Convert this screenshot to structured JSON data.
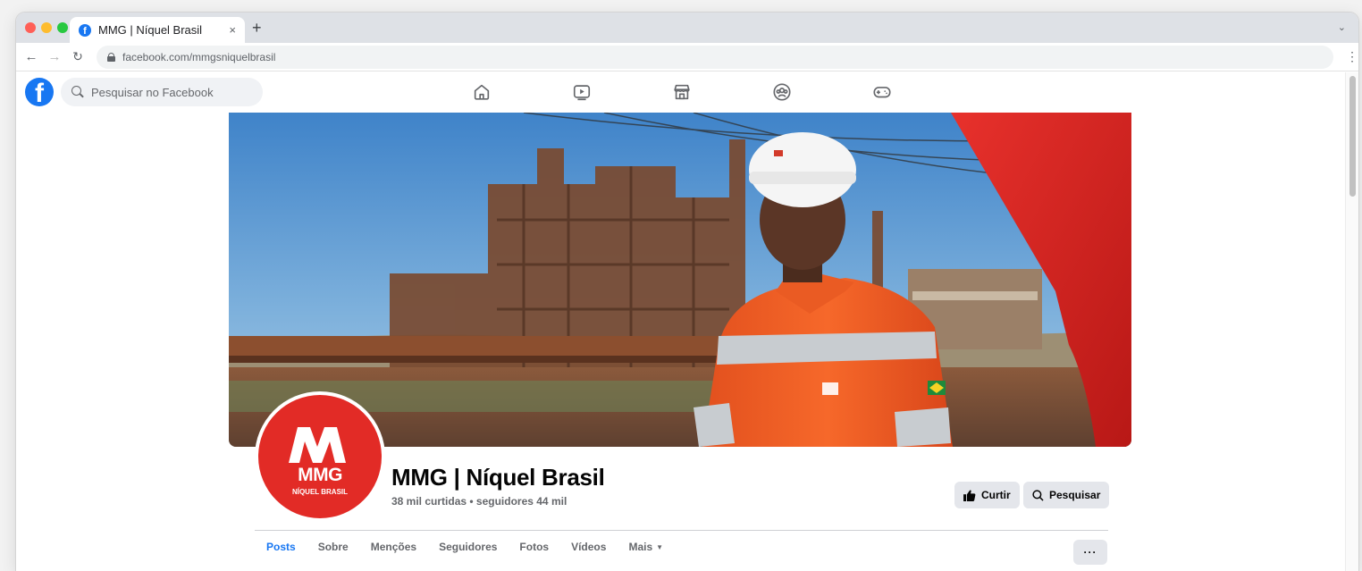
{
  "browser": {
    "tab_title": "MMG | Níquel Brasil",
    "url": "facebook.com/mmgsniquelbrasil",
    "new_tab": "+",
    "close_tab": "×"
  },
  "facebook": {
    "logo": "f",
    "search_placeholder": "Pesquisar no Facebook",
    "nav_icons": [
      "home-icon",
      "watch-icon",
      "marketplace-icon",
      "groups-icon",
      "gaming-icon"
    ]
  },
  "page": {
    "name": "MMG | Níquel Brasil",
    "stats": "38 mil curtidas • seguidores 44 mil",
    "avatar_logo": "MMG",
    "avatar_sub": "NÍQUEL BRASIL",
    "like_button": "Curtir",
    "search_button": "Pesquisar",
    "more_button": "···",
    "tabs": [
      "Posts",
      "Sobre",
      "Menções",
      "Seguidores",
      "Fotos",
      "Vídeos",
      "Mais"
    ],
    "active_tab": "Posts"
  },
  "colors": {
    "facebook_blue": "#1877f2",
    "brand_red": "#e22b26"
  }
}
